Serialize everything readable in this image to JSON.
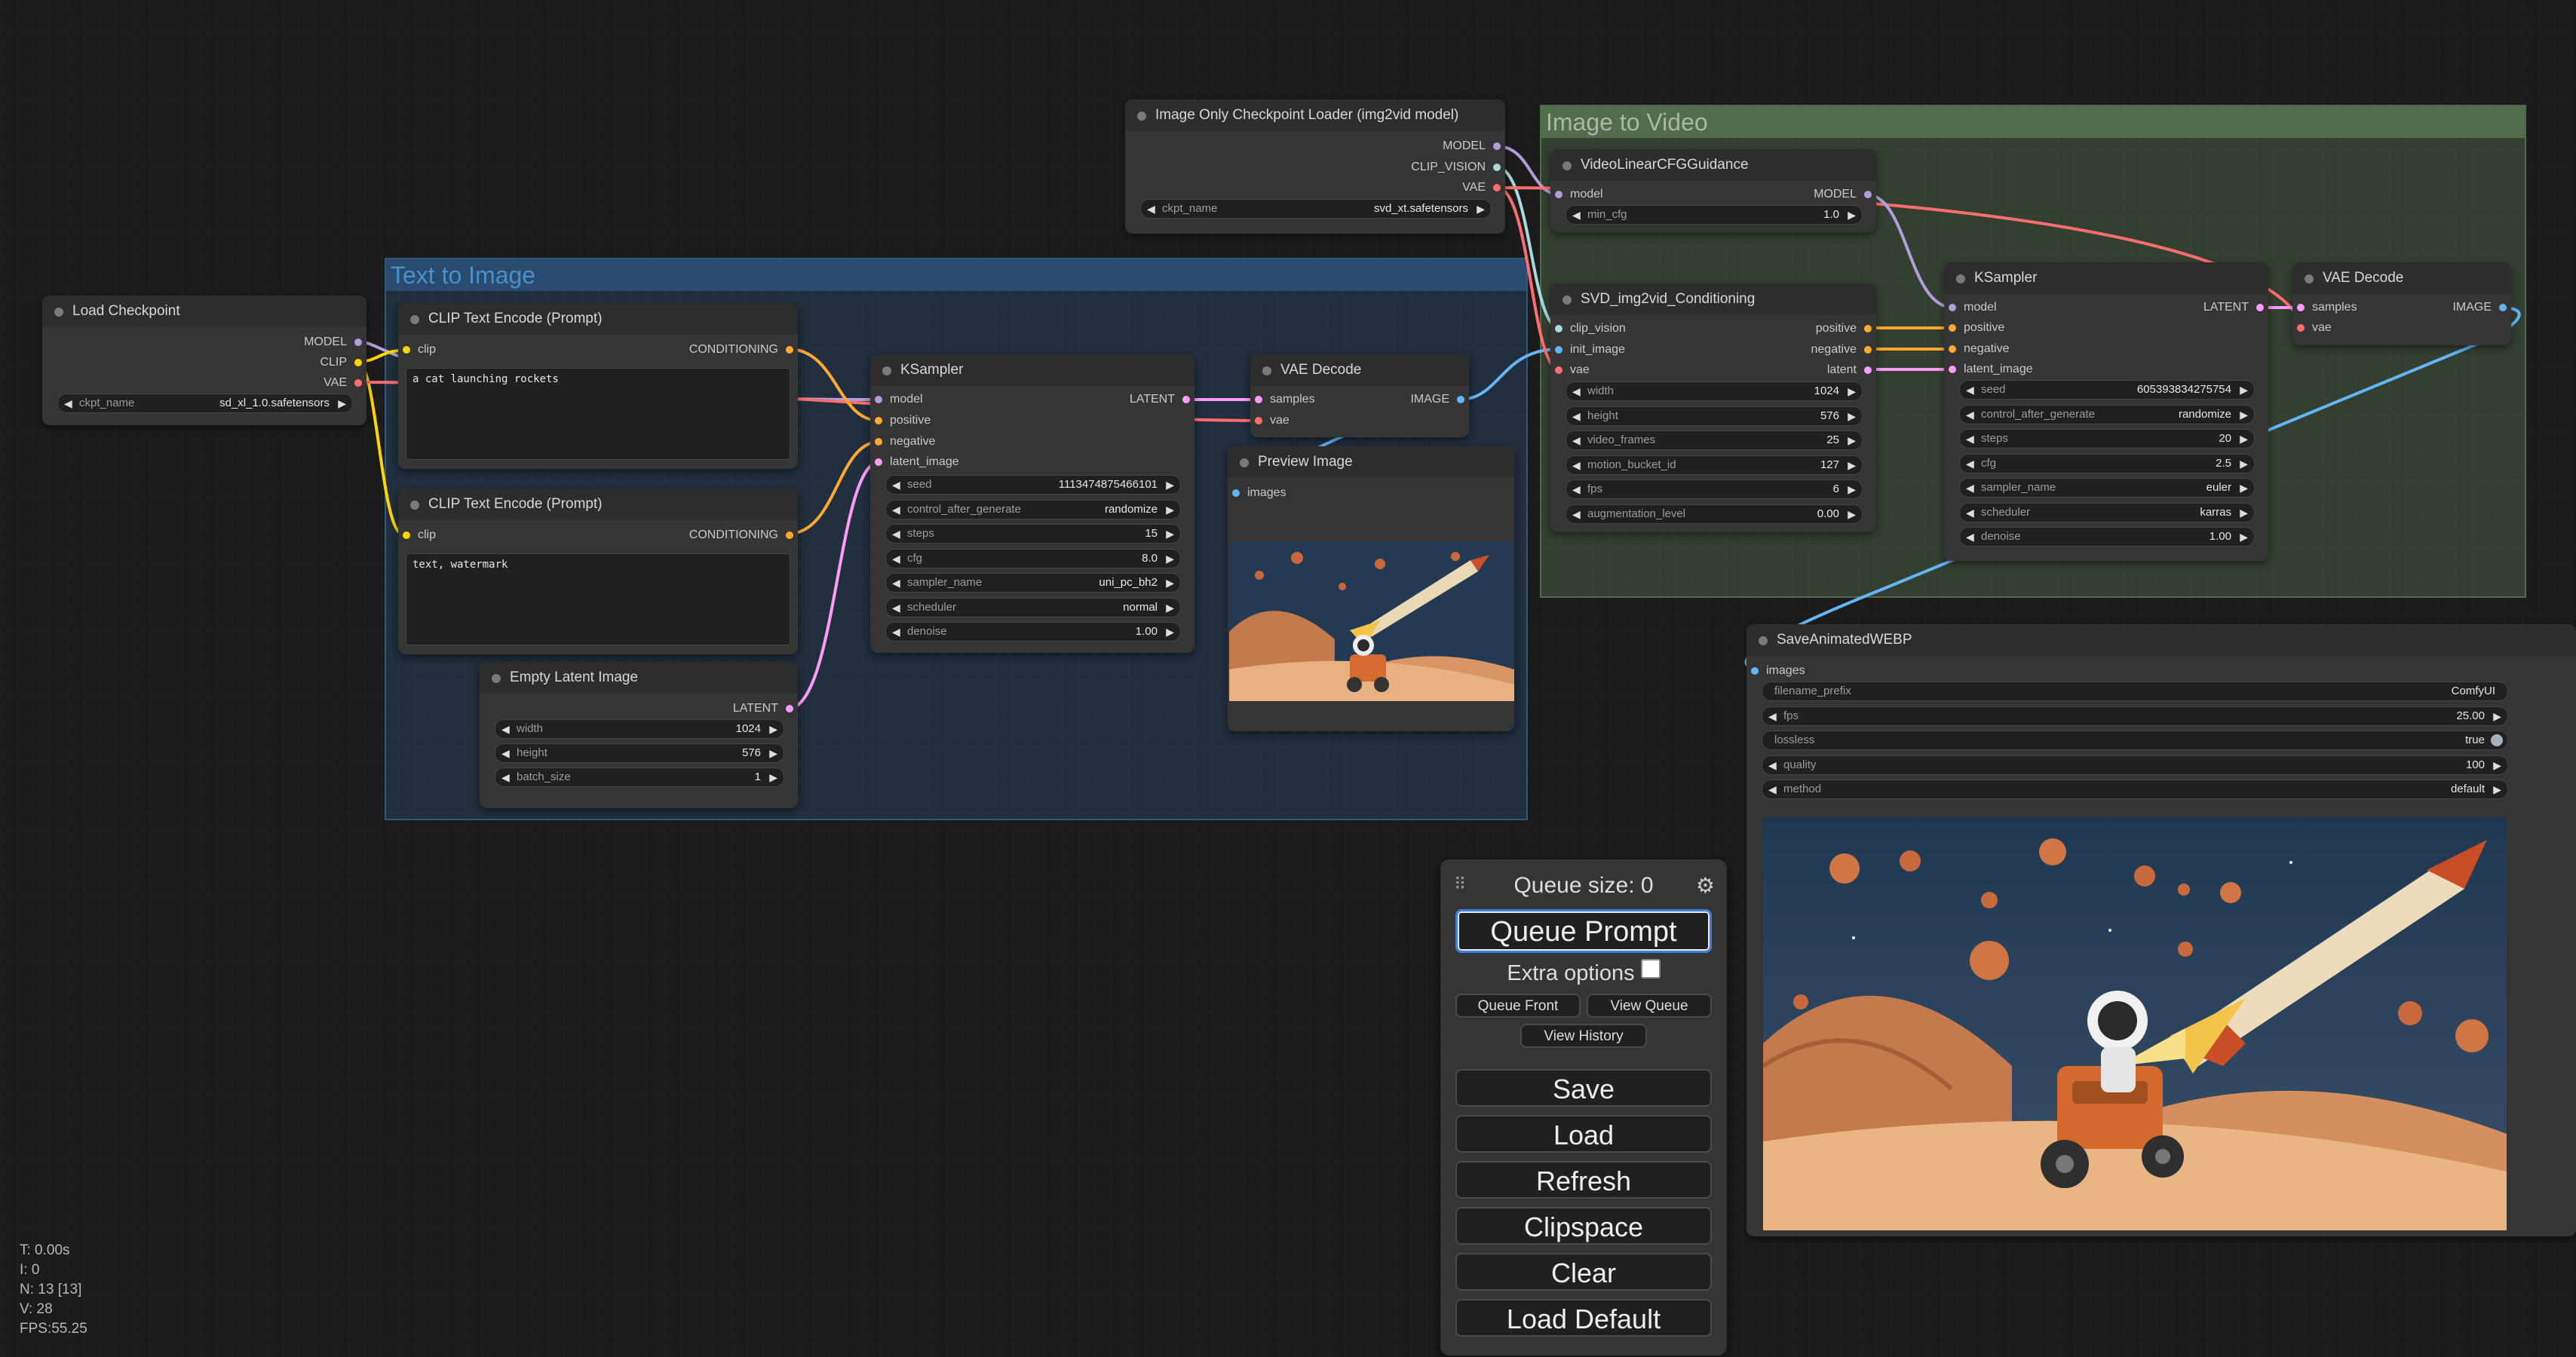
{
  "colors": {
    "model": "#b39ddb",
    "clip": "#ffd500",
    "vae": "#ff6e6e",
    "conditioning": "#ffa931",
    "latent": "#ff9cf9",
    "image": "#64b5f6",
    "clip_vision": "#a8dadc"
  },
  "groups": {
    "t2i": "Text to Image",
    "i2v": "Image to Video"
  },
  "load_checkpoint": {
    "title": "Load Checkpoint",
    "out_model": "MODEL",
    "out_clip": "CLIP",
    "out_vae": "VAE",
    "w_name": "ckpt_name",
    "w_value": "sd_xl_1.0.safetensors"
  },
  "clip_pos": {
    "title": "CLIP Text Encode (Prompt)",
    "in_clip": "clip",
    "out": "CONDITIONING",
    "text": "a cat launching rockets"
  },
  "clip_neg": {
    "title": "CLIP Text Encode (Prompt)",
    "in_clip": "clip",
    "out": "CONDITIONING",
    "text": "text, watermark"
  },
  "empty_latent": {
    "title": "Empty Latent Image",
    "out": "LATENT",
    "widgets": [
      {
        "name": "width",
        "value": "1024"
      },
      {
        "name": "height",
        "value": "576"
      },
      {
        "name": "batch_size",
        "value": "1"
      }
    ]
  },
  "ksampler1": {
    "title": "KSampler",
    "inputs": [
      "model",
      "positive",
      "negative",
      "latent_image"
    ],
    "out": "LATENT",
    "widgets": [
      {
        "name": "seed",
        "value": "1113474875466101"
      },
      {
        "name": "control_after_generate",
        "value": "randomize"
      },
      {
        "name": "steps",
        "value": "15"
      },
      {
        "name": "cfg",
        "value": "8.0"
      },
      {
        "name": "sampler_name",
        "value": "uni_pc_bh2"
      },
      {
        "name": "scheduler",
        "value": "normal"
      },
      {
        "name": "denoise",
        "value": "1.00"
      }
    ]
  },
  "vae_decode1": {
    "title": "VAE Decode",
    "in_samples": "samples",
    "in_vae": "vae",
    "out": "IMAGE"
  },
  "preview": {
    "title": "Preview Image",
    "in_images": "images"
  },
  "img_only_loader": {
    "title": "Image Only Checkpoint Loader (img2vid model)",
    "out_model": "MODEL",
    "out_clip_vision": "CLIP_VISION",
    "out_vae": "VAE",
    "w_name": "ckpt_name",
    "w_value": "svd_xt.safetensors"
  },
  "video_cfg": {
    "title": "VideoLinearCFGGuidance",
    "in_model": "model",
    "out": "MODEL",
    "w_name": "min_cfg",
    "w_value": "1.0"
  },
  "svd_cond": {
    "title": "SVD_img2vid_Conditioning",
    "in_clip_vision": "clip_vision",
    "in_init_image": "init_image",
    "in_vae": "vae",
    "out_positive": "positive",
    "out_negative": "negative",
    "out_latent": "latent",
    "widgets": [
      {
        "name": "width",
        "value": "1024"
      },
      {
        "name": "height",
        "value": "576"
      },
      {
        "name": "video_frames",
        "value": "25"
      },
      {
        "name": "motion_bucket_id",
        "value": "127"
      },
      {
        "name": "fps",
        "value": "6"
      },
      {
        "name": "augmentation_level",
        "value": "0.00"
      }
    ]
  },
  "ksampler2": {
    "title": "KSampler",
    "inputs": [
      "model",
      "positive",
      "negative",
      "latent_image"
    ],
    "out": "LATENT",
    "widgets": [
      {
        "name": "seed",
        "value": "605393834275754"
      },
      {
        "name": "control_after_generate",
        "value": "randomize"
      },
      {
        "name": "steps",
        "value": "20"
      },
      {
        "name": "cfg",
        "value": "2.5"
      },
      {
        "name": "sampler_name",
        "value": "euler"
      },
      {
        "name": "scheduler",
        "value": "karras"
      },
      {
        "name": "denoise",
        "value": "1.00"
      }
    ]
  },
  "vae_decode2": {
    "title": "VAE Decode",
    "in_samples": "samples",
    "in_vae": "vae",
    "out": "IMAGE"
  },
  "save_webp": {
    "title": "SaveAnimatedWEBP",
    "in_images": "images",
    "widgets": [
      {
        "name": "filename_prefix",
        "value": "ComfyUI",
        "kind": "text"
      },
      {
        "name": "fps",
        "value": "25.00",
        "kind": "number"
      },
      {
        "name": "lossless",
        "value": "true",
        "kind": "toggle"
      },
      {
        "name": "quality",
        "value": "100",
        "kind": "number"
      },
      {
        "name": "method",
        "value": "default",
        "kind": "combo"
      }
    ]
  },
  "queue_panel": {
    "queue_size": "Queue size: 0",
    "queue_prompt": "Queue Prompt",
    "extra_options": "Extra options",
    "queue_front": "Queue Front",
    "view_queue": "View Queue",
    "view_history": "View History",
    "save": "Save",
    "load": "Load",
    "refresh": "Refresh",
    "clipspace": "Clipspace",
    "clear": "Clear",
    "load_default": "Load Default"
  },
  "stats": {
    "t": "T: 0.00s",
    "i": "I: 0",
    "n": "N: 13 [13]",
    "v": "V: 28",
    "fps": "FPS:55.25"
  }
}
